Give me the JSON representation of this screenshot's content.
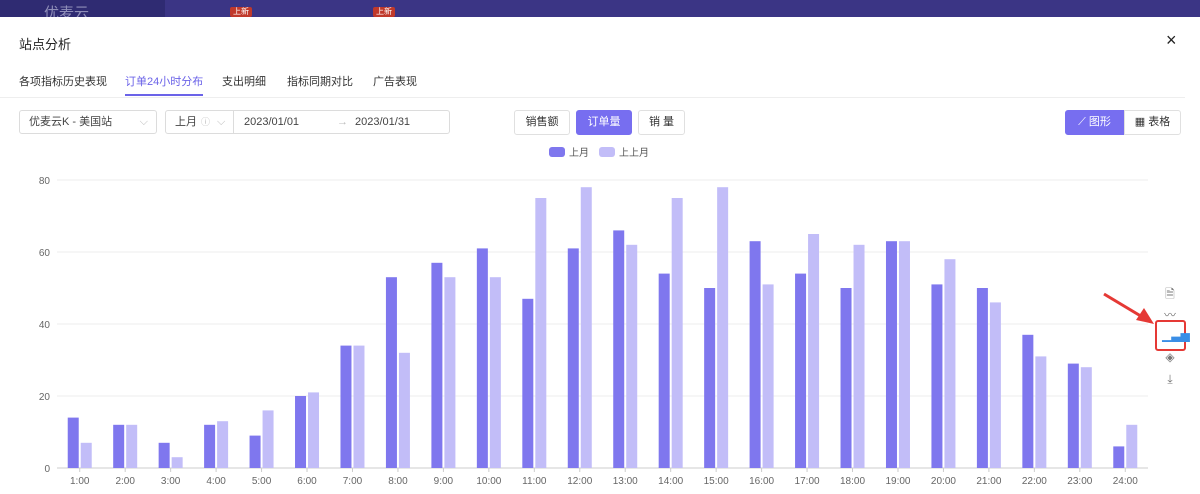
{
  "topbar": {
    "logo": "优麦云",
    "badges": [
      "上新",
      "上新"
    ]
  },
  "dialog": {
    "title": "站点分析",
    "close": "×"
  },
  "tabs": [
    {
      "label": "各项指标历史表现"
    },
    {
      "label": "订单24小时分布"
    },
    {
      "label": "支出明细"
    },
    {
      "label": "指标同期对比"
    },
    {
      "label": "广告表现"
    }
  ],
  "filters": {
    "shop": "优麦云K - 美国站",
    "period": "上月",
    "start": "2023/01/01",
    "arrow": "→",
    "end": "2023/01/31"
  },
  "metric_buttons": [
    "销售额",
    "订单量",
    "销 量"
  ],
  "view_buttons": {
    "chart": "图形",
    "table": "表格"
  },
  "colors": {
    "current": "#7f77ee",
    "previous": "#c2bdf8",
    "accent": "#6b63e8"
  },
  "chart_data": {
    "type": "bar",
    "categories": [
      "1:00",
      "2:00",
      "3:00",
      "4:00",
      "5:00",
      "6:00",
      "7:00",
      "8:00",
      "9:00",
      "10:00",
      "11:00",
      "12:00",
      "13:00",
      "14:00",
      "15:00",
      "16:00",
      "17:00",
      "18:00",
      "19:00",
      "20:00",
      "21:00",
      "22:00",
      "23:00",
      "24:00"
    ],
    "series": [
      {
        "name": "上月",
        "values": [
          14,
          12,
          7,
          12,
          9,
          20,
          34,
          53,
          57,
          61,
          47,
          61,
          66,
          54,
          50,
          63,
          54,
          50,
          63,
          51,
          50,
          37,
          29,
          6
        ]
      },
      {
        "name": "上上月",
        "values": [
          7,
          12,
          3,
          13,
          16,
          21,
          34,
          32,
          53,
          53,
          75,
          78,
          62,
          75,
          78,
          51,
          65,
          62,
          63,
          58,
          46,
          31,
          28,
          12
        ]
      }
    ],
    "yticks": [
      "0",
      "20",
      "40",
      "60",
      "80"
    ],
    "ylim": [
      0,
      80
    ],
    "grid": true,
    "legend": "top-center"
  }
}
